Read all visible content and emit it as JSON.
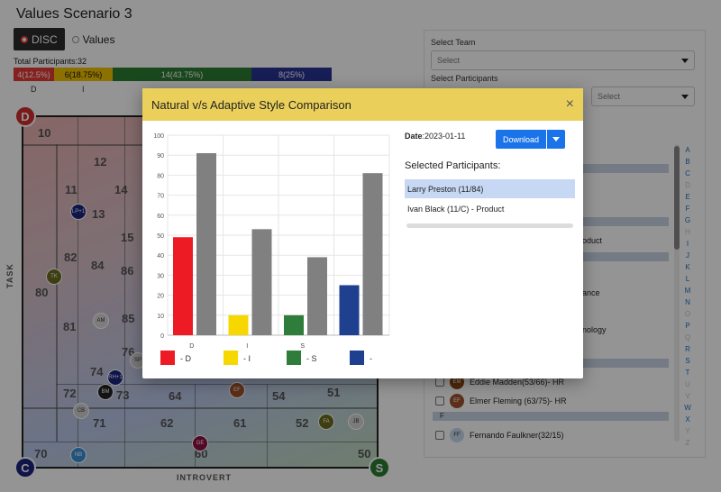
{
  "page": {
    "title": "Values Scenario 3"
  },
  "mode": {
    "options": [
      "DISC",
      "Values"
    ],
    "selected": "DISC"
  },
  "summary": {
    "total_label": "Total Participants:32",
    "segments": [
      {
        "key": "D",
        "text": "4(12.5%)",
        "color": "#e53935",
        "fraction": 0.125
      },
      {
        "key": "I",
        "text": "6(18.75%)",
        "color": "#f2c200",
        "fraction": 0.1875
      },
      {
        "key": "S",
        "text": "14(43.75%)",
        "color": "#2e7d32",
        "fraction": 0.4375
      },
      {
        "key": "C",
        "text": "8(25%)",
        "color": "#283593",
        "fraction": 0.25
      }
    ]
  },
  "disc_map": {
    "axis_left": "TASK",
    "axis_bottom": "INTROVERT",
    "corners": {
      "D": "D",
      "C": "C",
      "S": "S"
    },
    "numbers": [
      "10",
      "12",
      "14",
      "11",
      "13",
      "15",
      "82",
      "84",
      "86",
      "80",
      "81",
      "85",
      "76",
      "74",
      "73",
      "72",
      "71",
      "64",
      "62",
      "61",
      "54",
      "52",
      "51",
      "70",
      "60",
      "50"
    ],
    "bubbles": [
      {
        "label": "LP+1",
        "color": "#1a237e"
      },
      {
        "label": "TK",
        "color": "#6b6b1e"
      },
      {
        "label": "AM",
        "color": "#d8d8d8"
      },
      {
        "label": "SP",
        "color": "#cfcfcf"
      },
      {
        "label": "RH+1",
        "color": "#1a237e"
      },
      {
        "label": "BM",
        "color": "#222222"
      },
      {
        "label": "CB",
        "color": "#d0d0d0"
      },
      {
        "label": "EF",
        "color": "#a0522d"
      },
      {
        "label": "FA",
        "color": "#6b6b1e"
      },
      {
        "label": "JB",
        "color": "#d4d4d4"
      },
      {
        "label": "GE",
        "color": "#8e1040"
      },
      {
        "label": "NB",
        "color": "#3a8fd8"
      }
    ]
  },
  "sidebar": {
    "team_label": "Select Team",
    "team_placeholder": "Select",
    "participants_label": "Select Participants",
    "participants_placeholder": "Select",
    "partial_texts": [
      "oduct",
      "ance",
      "nology"
    ],
    "rows": [
      {
        "initials": "EM",
        "name": "Eddie Madden(53/66)- HR",
        "color": "#8b4513"
      },
      {
        "initials": "EF",
        "name": "Elmer Fleming (63/75)- HR",
        "color": "#a0522d"
      },
      {
        "initials": "FF",
        "name": "Fernando Faulkner(32/15)",
        "color": "#c8d8ee"
      }
    ],
    "section_f": "F",
    "alphabet": [
      "A",
      "B",
      "C",
      "D",
      "E",
      "F",
      "G",
      "H",
      "I",
      "J",
      "K",
      "L",
      "M",
      "N",
      "O",
      "P",
      "Q",
      "R",
      "S",
      "T",
      "U",
      "V",
      "W",
      "X",
      "Y",
      "Z"
    ],
    "alphabet_dim": [
      "D",
      "H",
      "O",
      "Q",
      "U",
      "V",
      "Y",
      "Z"
    ]
  },
  "modal": {
    "title": "Natural v/s Adaptive Style Comparison",
    "close": "×",
    "date_label": "Date",
    "date_value": ":2023-01-11",
    "download_label": "Download",
    "selected_title": "Selected Participants:",
    "participants": [
      "Larry Preston (11/84)",
      "Ivan Black (11/C) - Product"
    ],
    "selected_index": 0
  },
  "chart_data": {
    "type": "bar",
    "categories": [
      "D",
      "I",
      "S",
      ""
    ],
    "ylim": [
      0,
      100
    ],
    "yticks": [
      0,
      10,
      20,
      30,
      40,
      50,
      60,
      70,
      80,
      90,
      100
    ],
    "series": [
      {
        "name": "natural",
        "values": [
          49,
          10,
          10,
          25
        ],
        "colors": [
          "#ed1c24",
          "#f6d800",
          "#2e7d3a",
          "#1f3f8f"
        ]
      },
      {
        "name": "adaptive",
        "values": [
          91,
          53,
          39,
          81
        ],
        "colors": [
          "#808080",
          "#808080",
          "#808080",
          "#808080"
        ]
      }
    ],
    "legend": [
      {
        "label": "- D",
        "color": "#ed1c24"
      },
      {
        "label": "- I",
        "color": "#f6d800"
      },
      {
        "label": "- S",
        "color": "#2e7d3a"
      },
      {
        "label": "-",
        "color": "#1f3f8f"
      }
    ],
    "grid": true
  }
}
